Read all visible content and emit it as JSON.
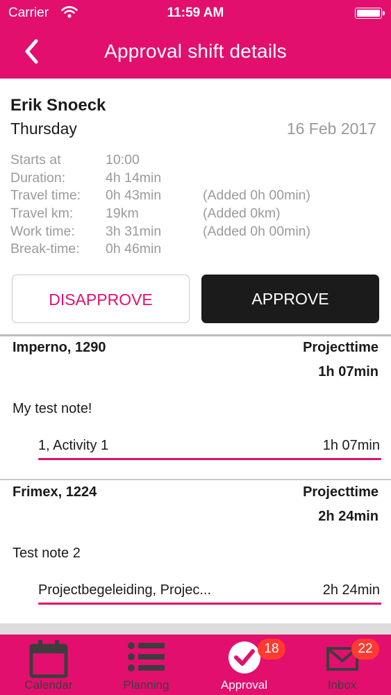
{
  "status_bar": {
    "carrier": "Carrier",
    "time": "11:59 AM"
  },
  "header": {
    "title": "Approval shift details",
    "back_icon": "chevron-left-icon"
  },
  "shift": {
    "employee": "Erik Snoeck",
    "day": "Thursday",
    "date": "16 Feb 2017",
    "details": [
      {
        "label": "Starts at",
        "value": "10:00",
        "extra": ""
      },
      {
        "label": "Duration:",
        "value": "4h 14min",
        "extra": ""
      },
      {
        "label": "Travel time:",
        "value": "0h 43min",
        "extra": "(Added 0h 00min)"
      },
      {
        "label": "Travel km:",
        "value": "19km",
        "extra": "(Added 0km)"
      },
      {
        "label": "Work time:",
        "value": "3h 31min",
        "extra": "(Added 0h 00min)"
      },
      {
        "label": "Break-time:",
        "value": "0h 46min",
        "extra": ""
      }
    ]
  },
  "actions": {
    "disapprove": "DISAPPROVE",
    "approve": "APPROVE"
  },
  "projects": [
    {
      "name": "Imperno, 1290",
      "type": "Projecttime",
      "total": "1h 07min",
      "note": "My test note!",
      "activities": [
        {
          "name": "1, Activity 1",
          "duration": "1h 07min"
        }
      ]
    },
    {
      "name": "Frimex, 1224",
      "type": "Projecttime",
      "total": "2h 24min",
      "note": "Test note 2",
      "activities": [
        {
          "name": "Projectbegeleiding, Projec...",
          "duration": "2h 24min"
        }
      ]
    }
  ],
  "tabs": [
    {
      "label": "Calendar",
      "icon": "calendar-icon",
      "badge": ""
    },
    {
      "label": "Planning",
      "icon": "list-icon",
      "badge": ""
    },
    {
      "label": "Approval",
      "icon": "checkmark-circle-icon",
      "badge": "18"
    },
    {
      "label": "Inbox",
      "icon": "envelope-icon",
      "badge": "22"
    }
  ],
  "colors": {
    "accent": "#e20f6f",
    "approve_bg": "#1b1b1b",
    "badge": "#ff3b30",
    "muted_text": "#9a9a9a"
  }
}
